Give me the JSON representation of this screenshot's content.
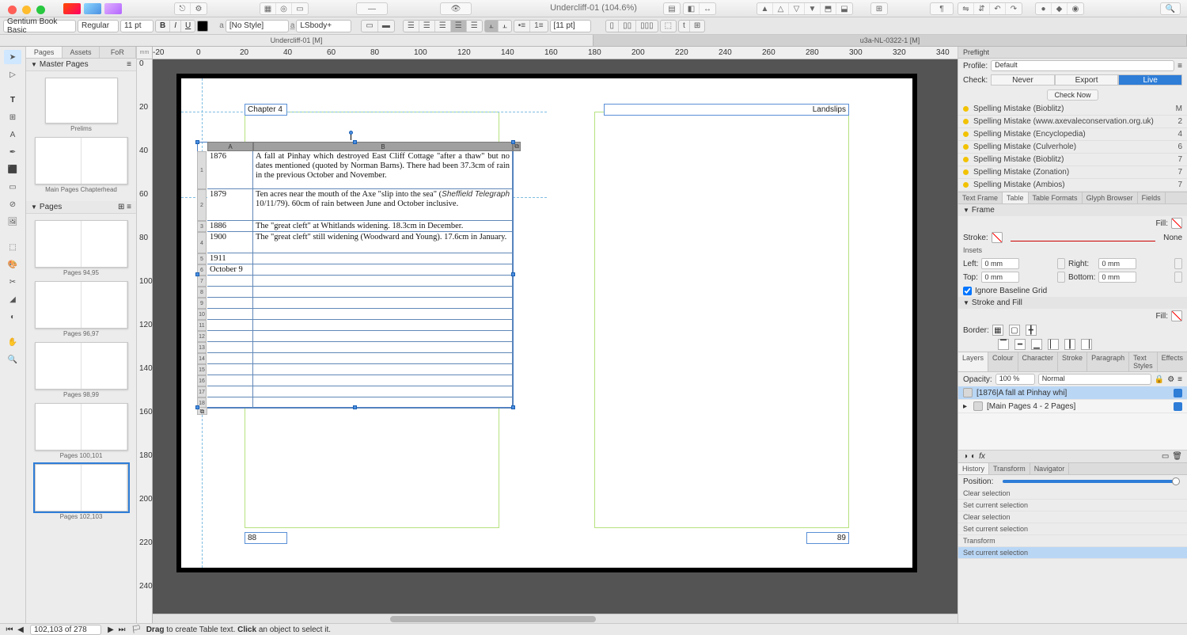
{
  "titlebar": {
    "doc_title": "Undercliff-01 (104.6%)"
  },
  "context": {
    "font": "Gentium Book Basic",
    "weight": "Regular",
    "size": "11 pt",
    "para_style": "[No Style]",
    "char_style": "LSbody+",
    "leading": "[11 pt]"
  },
  "doc_tabs": [
    "Undercliff-01 [M]",
    "u3a-NL-0322-1 [M]"
  ],
  "left_pane": {
    "tabs": [
      "Pages",
      "Assets",
      "FoR"
    ],
    "master_header": "Master Pages",
    "pages_header": "Pages",
    "thumbs": [
      {
        "label": "Prelims",
        "spread": false
      },
      {
        "label": "Main Pages Chapterhead",
        "spread": true
      },
      {
        "label": "Pages 94,95",
        "spread": true
      },
      {
        "label": "Pages 96,97",
        "spread": true
      },
      {
        "label": "Pages 98,99",
        "spread": true
      },
      {
        "label": "Pages 100,101",
        "spread": true
      },
      {
        "label": "Pages 102,103",
        "spread": true,
        "selected": true
      }
    ]
  },
  "ruler_unit": "mm",
  "page_content": {
    "chapter": "Chapter 4",
    "running_head": "Landslips",
    "folio_left": "88",
    "folio_right": "89",
    "col_headers": [
      "A",
      "B"
    ],
    "rows": [
      {
        "a": "1876",
        "b": "A fall at Pinhay which destroyed East Cliff Cottage \"after a thaw\" but no dates mentioned (quoted by Norman Barns). There had been 37.3cm of rain in the previous October and November."
      },
      {
        "a": "1879",
        "b": "Ten acres near the mouth of the Axe \"slip into the sea\" (<i>Sheffield Telegraph</i> 10/11/79). 60cm of rain between June and October inclusive."
      },
      {
        "a": "1886",
        "b": "The \"great cleft\" at Whitlands widening. 18.3cm in December."
      },
      {
        "a": "1900",
        "b": "The \"great cleft\" still widening (Woodward and Young). 17.6cm in January."
      },
      {
        "a": "1911",
        "b": ""
      },
      {
        "a": "October 9",
        "b": ""
      }
    ],
    "row_count": 18
  },
  "preflight": {
    "header": "Preflight",
    "profile_label": "Profile:",
    "profile": "Default",
    "check_label": "Check:",
    "opts": [
      "Never",
      "Export",
      "Live"
    ],
    "btn": "Check Now",
    "items": [
      {
        "name": "Spelling Mistake (Bioblitz)",
        "count": "M"
      },
      {
        "name": "Spelling Mistake (www.axevaleconservation.org.uk)",
        "count": "2"
      },
      {
        "name": "Spelling Mistake (Encyclopedia)",
        "count": "4"
      },
      {
        "name": "Spelling Mistake (Culverhole)",
        "count": "6"
      },
      {
        "name": "Spelling Mistake (Bioblitz)",
        "count": "7"
      },
      {
        "name": "Spelling Mistake (Zonation)",
        "count": "7"
      },
      {
        "name": "Spelling Mistake (Ambios)",
        "count": "7"
      }
    ]
  },
  "obj_tabs": [
    "Text Frame",
    "Table",
    "Table Formats",
    "Glyph Browser",
    "Fields"
  ],
  "frame": {
    "header": "Frame",
    "fill": "Fill:",
    "stroke": "Stroke:",
    "stroke_style": "None",
    "insets": "Insets",
    "left": "Left:",
    "right": "Right:",
    "top": "Top:",
    "bottom": "Bottom:",
    "val": "0 mm",
    "ignore": "Ignore Baseline Grid",
    "sf": "Stroke and Fill",
    "border": "Border:"
  },
  "layers": {
    "tabs": [
      "Layers",
      "Colour",
      "Character",
      "Stroke",
      "Paragraph",
      "Text Styles",
      "Effects"
    ],
    "opacity_label": "Opacity:",
    "opacity": "100 %",
    "blend": "Normal",
    "items": [
      {
        "name": "[1876|A fall at Pinhay whi]",
        "selected": true
      },
      {
        "name": "[Main Pages 4 - 2 Pages]"
      }
    ]
  },
  "history": {
    "tabs": [
      "History",
      "Transform",
      "Navigator"
    ],
    "pos": "Position:",
    "items": [
      "Clear selection",
      "Set current selection",
      "Clear selection",
      "Set current selection",
      "Transform",
      "Set current selection"
    ]
  },
  "status": {
    "page": "102,103 of 278",
    "hint_drag": "Drag",
    "hint_mid": " to create Table text. ",
    "hint_click": "Click",
    "hint_end": " an object to select it."
  }
}
